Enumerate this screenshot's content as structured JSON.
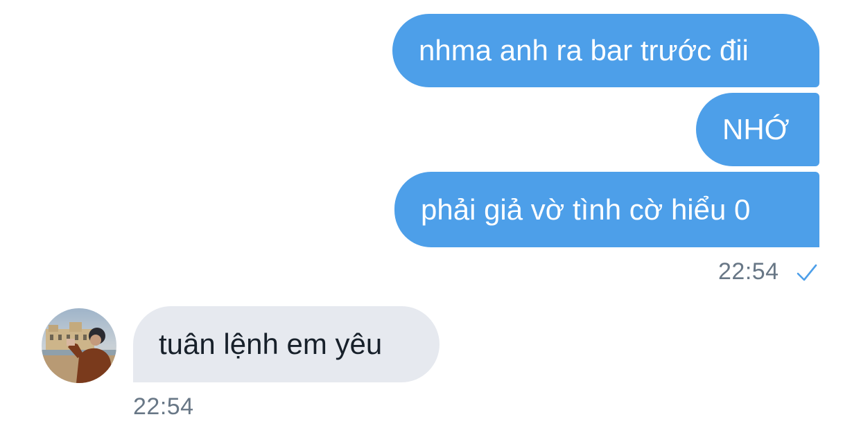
{
  "conversation": {
    "outgoing": [
      {
        "text": "nhma anh ra bar trước đii"
      },
      {
        "text": "NHỚ"
      },
      {
        "text": "phải giả vờ tình cờ hiểu 0"
      }
    ],
    "outgoing_time": "22:54",
    "outgoing_status_icon": "check-icon",
    "incoming": [
      {
        "text": "tuân lệnh em yêu"
      }
    ],
    "incoming_time": "22:54"
  },
  "colors": {
    "outgoing_bubble": "#4d9fe9",
    "incoming_bubble": "#e6e9ef",
    "timestamp": "#687786",
    "check": "#4d9fe9"
  }
}
